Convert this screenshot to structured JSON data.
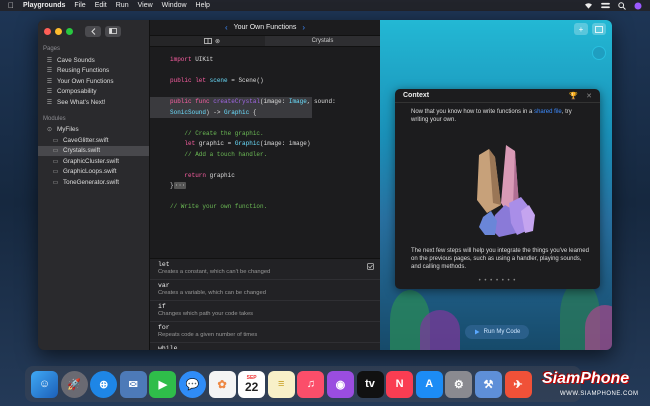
{
  "menubar": {
    "apple": "",
    "app_name": "Playgrounds",
    "items": [
      "File",
      "Edit",
      "Run",
      "View",
      "Window",
      "Help"
    ]
  },
  "sidebar": {
    "pages_header": "Pages",
    "pages": [
      "Cave Sounds",
      "Reusing Functions",
      "Your Own Functions",
      "Composability",
      "See What's Next!"
    ],
    "modules_header": "Modules",
    "module": "MyFiles",
    "files": [
      "CaveGlitter.swift",
      "Crystals.swift",
      "GraphicCluster.swift",
      "GraphicLoops.swift",
      "ToneGenerator.swift"
    ],
    "selected_file": "Crystals.swift"
  },
  "editor": {
    "title": "Your Own Functions",
    "tab_right": "Crystals"
  },
  "completions": [
    {
      "term": "let",
      "desc": "Creates a constant, which can't be changed"
    },
    {
      "term": "var",
      "desc": "Creates a variable, which can be changed"
    },
    {
      "term": "if",
      "desc": "Changes which path your code takes"
    },
    {
      "term": "for",
      "desc": "Repeats code a given number of times"
    }
  ],
  "completion_partial": "while",
  "context_card": {
    "title": "Context",
    "intro_before": "Now that you know how to write functions in a ",
    "intro_link": "shared file",
    "intro_after": ", try writing your own.",
    "body": "The next few steps will help you integrate the things you've learned on the previous pages, such as using a handler, playing sounds, and calling methods.",
    "dots": "• • • • • • •"
  },
  "run_button": "Run My Code",
  "dock": {
    "calendar_month": "SEP",
    "calendar_day": "22"
  },
  "watermark": {
    "brand": "SiamPhone",
    "url": "WWW.SIAMPHONE.COM"
  },
  "colors": {
    "accent": "#3d8bff",
    "keyword": "#fc5fa3",
    "function": "#a167e6",
    "type": "#6bdfff",
    "comment": "#6cbb55"
  }
}
